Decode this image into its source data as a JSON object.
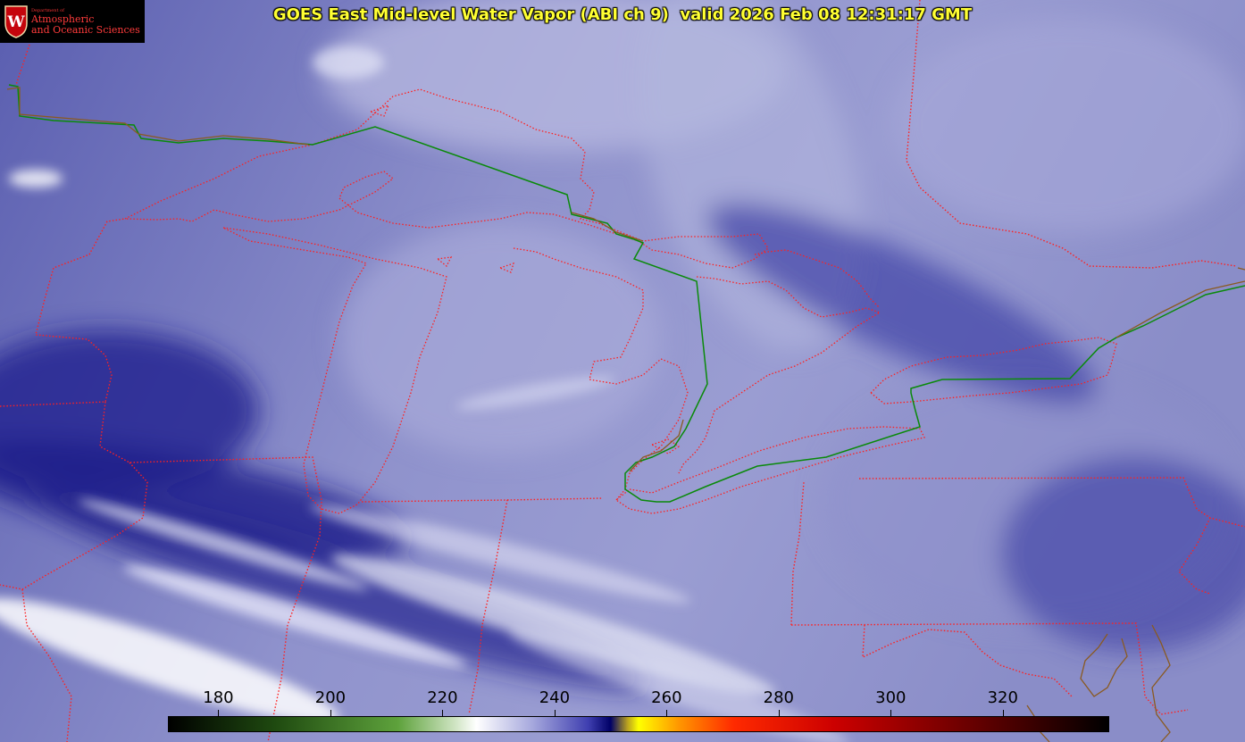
{
  "title": "GOES East Mid-level Water Vapor (ABI ch 9)  valid 2026 Feb 08 12:31:17 GMT",
  "logo": {
    "line1": "Department of",
    "line2": "Atmospheric",
    "line3": "and Oceanic Sciences",
    "crest_letter": "W"
  },
  "colorbar": {
    "ticks": [
      "180",
      "200",
      "220",
      "240",
      "260",
      "280",
      "300",
      "320"
    ],
    "range": [
      171,
      339
    ],
    "stops": [
      {
        "value": 171,
        "color": "#000000"
      },
      {
        "value": 190,
        "color": "#1f4a10"
      },
      {
        "value": 212,
        "color": "#5ea23c"
      },
      {
        "value": 222,
        "color": "#cde3c0"
      },
      {
        "value": 226,
        "color": "#ffffff"
      },
      {
        "value": 236,
        "color": "#a6a8dd"
      },
      {
        "value": 246,
        "color": "#3f3fb0"
      },
      {
        "value": 250,
        "color": "#000066"
      },
      {
        "value": 253,
        "color": "#b8a020"
      },
      {
        "value": 255,
        "color": "#ffff00"
      },
      {
        "value": 262,
        "color": "#ff9900"
      },
      {
        "value": 272,
        "color": "#ff2a00"
      },
      {
        "value": 290,
        "color": "#cc0000"
      },
      {
        "value": 315,
        "color": "#660000"
      },
      {
        "value": 339,
        "color": "#000000"
      }
    ]
  },
  "colors": {
    "state_borders": "#ff2020",
    "international_border": "#007a00",
    "coastline": "#8a5a20",
    "title_text": "#ffff33"
  }
}
